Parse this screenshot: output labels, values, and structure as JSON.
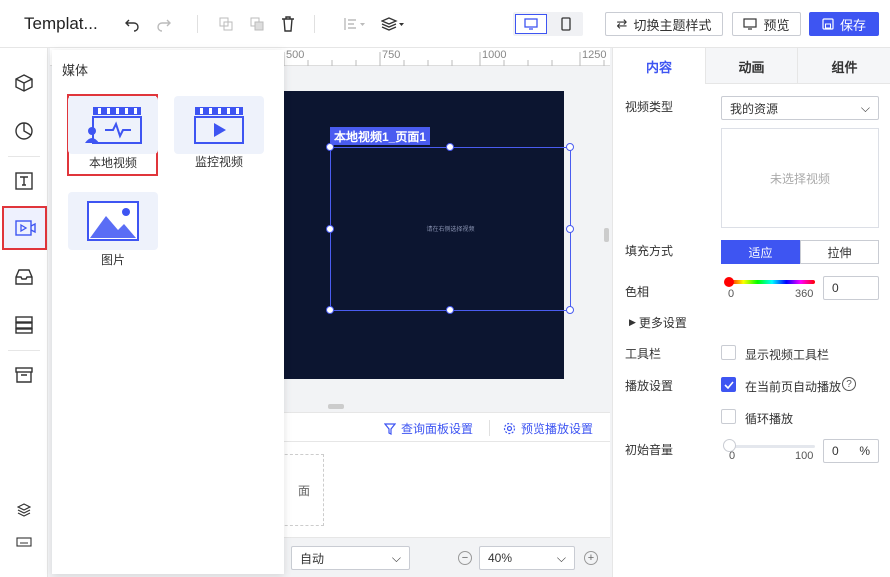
{
  "toolbar": {
    "title": "Templat...",
    "switch_theme_label": "切换主题样式",
    "preview_label": "预览",
    "save_label": "保存"
  },
  "media_panel": {
    "header": "媒体",
    "items": [
      {
        "label": "本地视频",
        "icon": "local-video-icon"
      },
      {
        "label": "监控视频",
        "icon": "monitor-video-icon"
      },
      {
        "label": "图片",
        "icon": "image-icon"
      }
    ]
  },
  "ruler": {
    "ticks": [
      "500",
      "750",
      "1000",
      "1250"
    ]
  },
  "canvas": {
    "component_tag": "本地视频1_页面1",
    "placeholder_text": "请在右侧选择视频"
  },
  "bottom_panel": {
    "query_settings_label": "查询面板设置",
    "preview_play_settings_label": "预览播放设置",
    "partial_text": "面",
    "mode_select": "自动",
    "zoom_value": "40%"
  },
  "right_panel": {
    "tabs": [
      "内容",
      "动画",
      "组件"
    ],
    "active_tab": "内容",
    "video_type_label": "视频类型",
    "video_type_value": "我的资源",
    "no_video_text": "未选择视频",
    "fill_mode_label": "填充方式",
    "fill_options": [
      "适应",
      "拉伸"
    ],
    "fill_selected": "适应",
    "hue_label": "色相",
    "hue_min": "0",
    "hue_max": "360",
    "hue_value": "0",
    "more_settings_label": "更多设置",
    "toolbar_label": "工具栏",
    "show_toolbar_label": "显示视频工具栏",
    "show_toolbar_checked": false,
    "playback_label": "播放设置",
    "autoplay_label": "在当前页自动播放",
    "autoplay_checked": true,
    "loop_label": "循环播放",
    "loop_checked": false,
    "volume_label": "初始音量",
    "volume_min": "0",
    "volume_max": "100",
    "volume_value": "0",
    "volume_unit": "%"
  },
  "colors": {
    "accent": "#3e55f2",
    "canvas_bg": "#0c1530",
    "highlight": "#e0353b"
  }
}
